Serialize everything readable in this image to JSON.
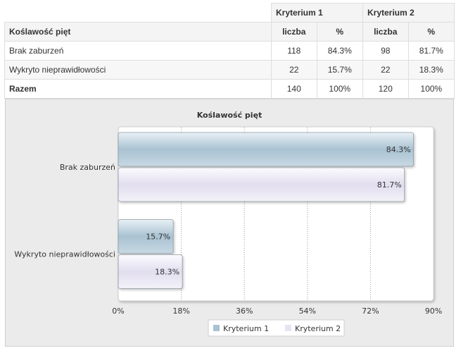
{
  "table": {
    "group_headers": [
      "Kryterium 1",
      "Kryterium 2"
    ],
    "row_header_label": "Koślawość pięt",
    "sub_headers": [
      "liczba",
      "%",
      "liczba",
      "%"
    ],
    "rows": [
      {
        "label": "Brak zaburzeń",
        "cells": [
          "118",
          "84.3%",
          "98",
          "81.7%"
        ]
      },
      {
        "label": "Wykryto nieprawidłowości",
        "cells": [
          "22",
          "15.7%",
          "22",
          "18.3%"
        ]
      }
    ],
    "total": {
      "label": "Razem",
      "cells": [
        "140",
        "100%",
        "120",
        "100%"
      ]
    }
  },
  "chart_data": {
    "type": "bar",
    "orientation": "horizontal",
    "title": "Koślawość pięt",
    "categories": [
      "Brak zaburzeń",
      "Wykryto nieprawidłowości"
    ],
    "series": [
      {
        "name": "Kryterium 1",
        "values": [
          84.3,
          15.7
        ],
        "labels": [
          "84.3%",
          "15.7%"
        ],
        "color": "#a9c2d2"
      },
      {
        "name": "Kryterium 2",
        "values": [
          81.7,
          18.3
        ],
        "labels": [
          "81.7%",
          "18.3%"
        ],
        "color": "#e7e4f1"
      }
    ],
    "xlim": [
      0,
      90
    ],
    "xticks": [
      0,
      18,
      36,
      54,
      72,
      90
    ],
    "xtick_labels": [
      "0%",
      "18%",
      "36%",
      "54%",
      "72%",
      "90%"
    ],
    "xlabel": "",
    "ylabel": "",
    "grid": true,
    "legend_position": "bottom"
  }
}
